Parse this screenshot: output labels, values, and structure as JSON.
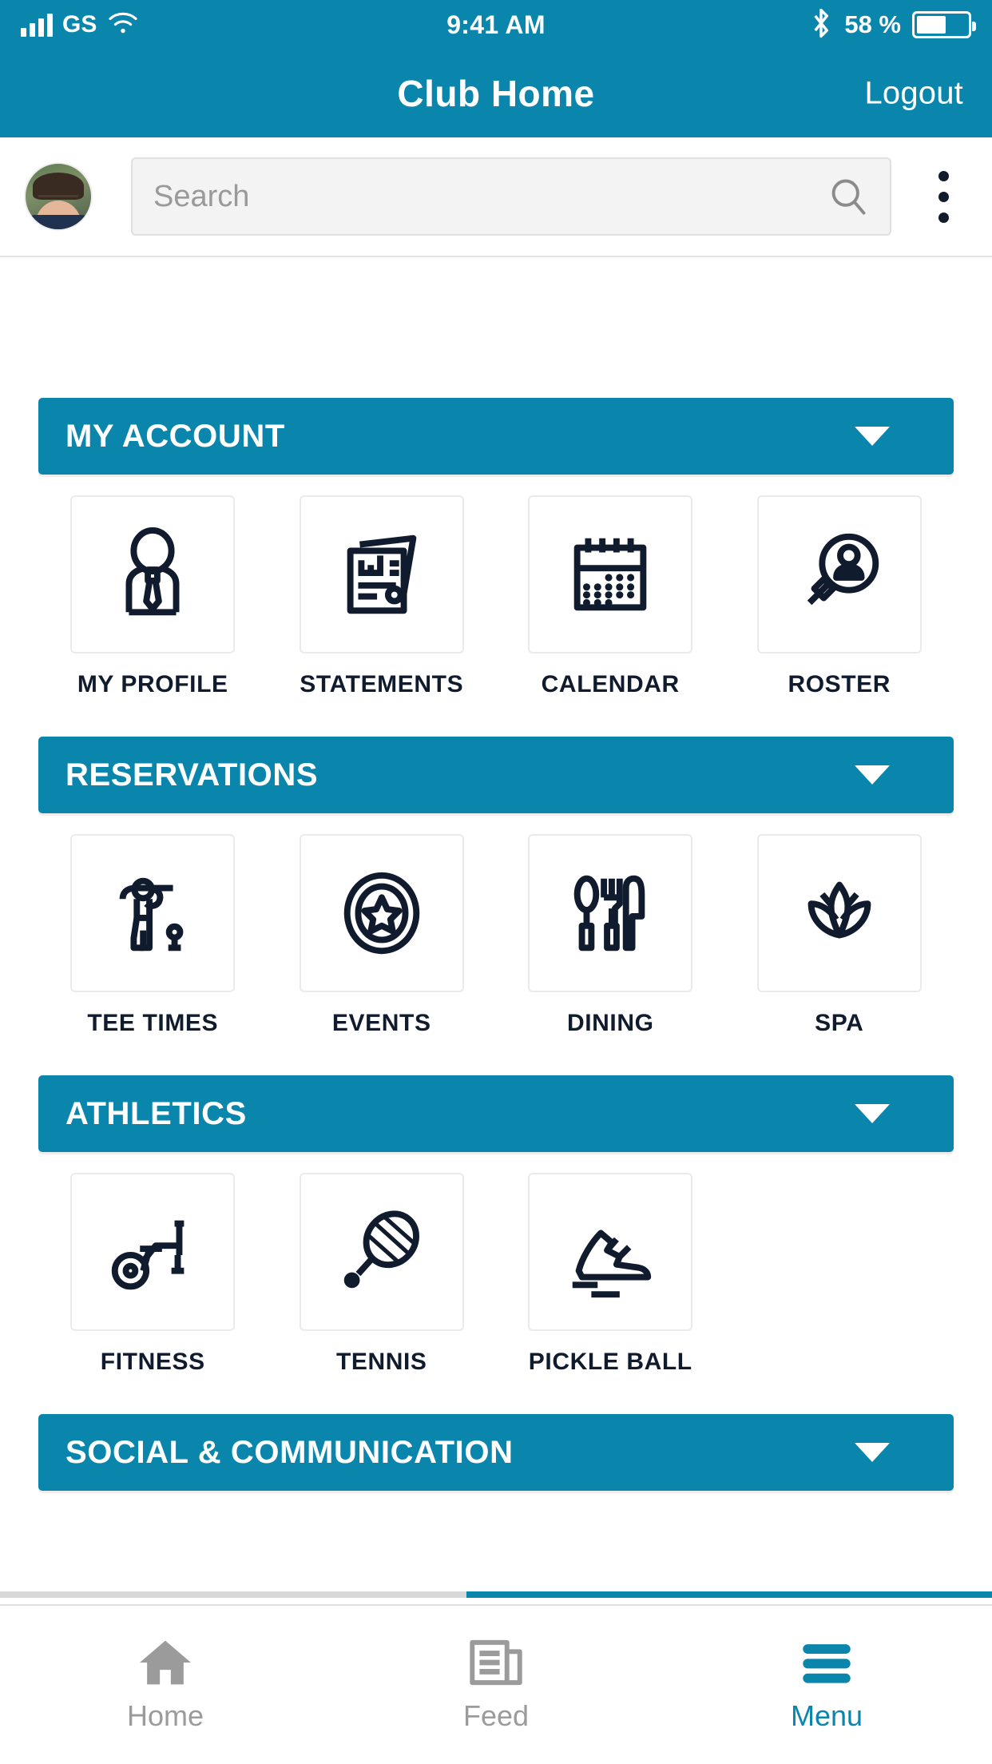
{
  "statusbar": {
    "carrier": "GS",
    "time": "9:41 AM",
    "battery_pct": "58 %",
    "signal_icon": "signal-bars-icon",
    "wifi_icon": "wifi-icon",
    "bluetooth_icon": "bluetooth-icon",
    "battery_icon": "battery-icon"
  },
  "navbar": {
    "title": "Club Home",
    "logout_label": "Logout"
  },
  "searchrow": {
    "avatar_name": "user-avatar",
    "search_placeholder": "Search",
    "search_value": "",
    "search_icon": "search-icon",
    "overflow_icon": "kebab-menu-icon"
  },
  "sections": [
    {
      "title": "MY ACCOUNT",
      "caret_icon": "chevron-down-icon",
      "tiles": [
        {
          "label": "MY PROFILE",
          "icon": "person-tie-icon"
        },
        {
          "label": "STATEMENTS",
          "icon": "documents-chart-icon"
        },
        {
          "label": "CALENDAR",
          "icon": "calendar-icon"
        },
        {
          "label": "ROSTER",
          "icon": "person-search-icon"
        }
      ]
    },
    {
      "title": "RESERVATIONS",
      "caret_icon": "chevron-down-icon",
      "tiles": [
        {
          "label": "TEE TIMES",
          "icon": "golfer-icon"
        },
        {
          "label": "EVENTS",
          "icon": "star-circle-icon"
        },
        {
          "label": "DINING",
          "icon": "cutlery-icon"
        },
        {
          "label": "SPA",
          "icon": "lotus-icon"
        }
      ]
    },
    {
      "title": "ATHLETICS",
      "caret_icon": "chevron-down-icon",
      "tiles": [
        {
          "label": "FITNESS",
          "icon": "exercise-bike-icon"
        },
        {
          "label": "TENNIS",
          "icon": "tennis-racket-icon"
        },
        {
          "label": "PICKLE BALL",
          "icon": "sneaker-icon"
        },
        {
          "label": "",
          "icon": ""
        }
      ]
    },
    {
      "title": "SOCIAL & COMMUNICATION",
      "caret_icon": "chevron-down-icon",
      "tiles": []
    }
  ],
  "tabbar": [
    {
      "label": "Home",
      "icon": "home-icon",
      "active": false
    },
    {
      "label": "Feed",
      "icon": "feed-icon",
      "active": false
    },
    {
      "label": "Menu",
      "icon": "hamburger-icon",
      "active": true
    }
  ],
  "colors": {
    "brand_blue": "#0a86ad",
    "icon_navy": "#111b2e",
    "tab_inactive": "#9b9b9b",
    "tile_border": "#eaeaea",
    "search_bg": "#f3f3f3"
  }
}
